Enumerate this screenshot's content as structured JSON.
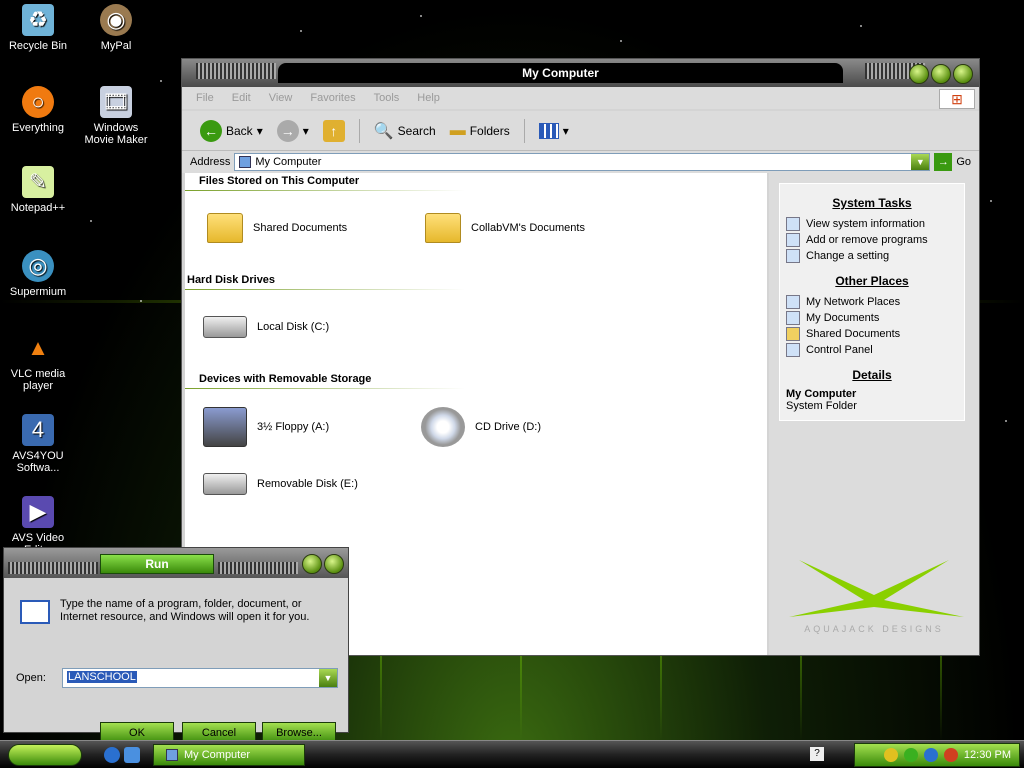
{
  "desktop": {
    "icons": [
      {
        "label": "Recycle Bin",
        "icon": "recycle-bin-icon"
      },
      {
        "label": "MyPal",
        "icon": "mypal-icon"
      },
      {
        "label": "Everything",
        "icon": "everything-icon"
      },
      {
        "label": "Windows Movie Maker",
        "icon": "movie-maker-icon"
      },
      {
        "label": "Notepad++",
        "icon": "notepad-plus-plus-icon"
      },
      {
        "label": "Supermium",
        "icon": "supermium-icon"
      },
      {
        "label": "VLC media player",
        "icon": "vlc-icon"
      },
      {
        "label": "AVS4YOU Softwa...",
        "icon": "avs4you-icon"
      },
      {
        "label": "AVS Video Edit...",
        "icon": "avs-video-icon"
      }
    ]
  },
  "explorer": {
    "title": "My Computer",
    "menu": [
      "File",
      "Edit",
      "View",
      "Favorites",
      "Tools",
      "Help"
    ],
    "toolbar": {
      "back": "Back",
      "search": "Search",
      "folders": "Folders"
    },
    "address": {
      "label": "Address",
      "value": "My Computer",
      "go": "Go"
    },
    "sections": {
      "files": "Files Stored on This Computer",
      "hdd": "Hard Disk Drives",
      "removable": "Devices with Removable Storage"
    },
    "items": {
      "shared_docs": "Shared Documents",
      "collab_docs": "CollabVM's Documents",
      "local_disk": "Local Disk (C:)",
      "floppy": "3½ Floppy (A:)",
      "cd": "CD Drive (D:)",
      "removable": "Removable Disk (E:)"
    },
    "side": {
      "system_tasks": "System Tasks",
      "tasks": [
        "View system information",
        "Add or remove programs",
        "Change a setting"
      ],
      "other_places": "Other Places",
      "places": [
        "My Network Places",
        "My Documents",
        "Shared Documents",
        "Control Panel"
      ],
      "details": "Details",
      "details_title": "My Computer",
      "details_sub": "System Folder",
      "brand": "AQUAJACK DESIGNS"
    }
  },
  "run": {
    "title": "Run",
    "message": "Type the name of a program, folder, document, or Internet resource, and Windows will open it for you.",
    "open_label": "Open:",
    "open_value": "LANSCHOOL",
    "ok": "OK",
    "cancel": "Cancel",
    "browse": "Browse..."
  },
  "taskbar": {
    "task": "My Computer",
    "clock": "12:30 PM"
  }
}
